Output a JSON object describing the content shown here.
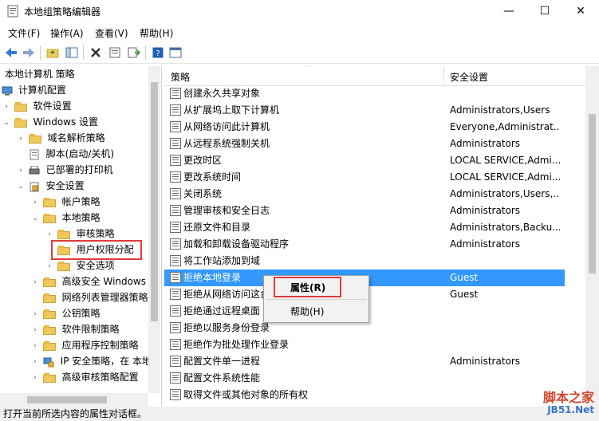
{
  "window": {
    "title": "本地组策略编辑器",
    "minimize": "—",
    "maximize": "☐",
    "close": "✕"
  },
  "menu": [
    "文件(F)",
    "操作(A)",
    "查看(V)",
    "帮助(H)"
  ],
  "tree": [
    {
      "label": "本地计算机 策略",
      "indent": 0,
      "arrow": "",
      "icon": "computer-icon"
    },
    {
      "label": "计算机配置",
      "indent": 1,
      "arrow": "",
      "icon": "computer-icon"
    },
    {
      "label": "软件设置",
      "indent": 1,
      "arrow": "›",
      "icon": "folder-icon"
    },
    {
      "label": "Windows 设置",
      "indent": 1,
      "arrow": "⌄",
      "icon": "folder-icon"
    },
    {
      "label": "域名解析策略",
      "indent": 2,
      "arrow": "›",
      "icon": "folder-icon"
    },
    {
      "label": "脚本(启动/关机)",
      "indent": 2,
      "arrow": "",
      "icon": "script-icon"
    },
    {
      "label": "已部署的打印机",
      "indent": 2,
      "arrow": "›",
      "icon": "printer-icon"
    },
    {
      "label": "安全设置",
      "indent": 2,
      "arrow": "⌄",
      "icon": "security-icon"
    },
    {
      "label": "帐户策略",
      "indent": 3,
      "arrow": "›",
      "icon": "folder-icon"
    },
    {
      "label": "本地策略",
      "indent": 3,
      "arrow": "⌄",
      "icon": "folder-icon"
    },
    {
      "label": "审核策略",
      "indent": 4,
      "arrow": "›",
      "icon": "folder-icon"
    },
    {
      "label": "用户权限分配",
      "indent": 4,
      "arrow": "",
      "icon": "folder-icon",
      "selected": true
    },
    {
      "label": "安全选项",
      "indent": 4,
      "arrow": "›",
      "icon": "folder-icon"
    },
    {
      "label": "高级安全 Windows",
      "indent": 3,
      "arrow": "›",
      "icon": "folder-icon"
    },
    {
      "label": "网络列表管理器策略",
      "indent": 3,
      "arrow": "",
      "icon": "folder-icon"
    },
    {
      "label": "公钥策略",
      "indent": 3,
      "arrow": "›",
      "icon": "folder-icon"
    },
    {
      "label": "软件限制策略",
      "indent": 3,
      "arrow": "›",
      "icon": "folder-icon"
    },
    {
      "label": "应用程序控制策略",
      "indent": 3,
      "arrow": "›",
      "icon": "folder-icon"
    },
    {
      "label": "IP 安全策略，在 本地",
      "indent": 3,
      "arrow": "›",
      "icon": "ip-security-icon"
    },
    {
      "label": "高级审核策略配置",
      "indent": 3,
      "arrow": "›",
      "icon": "folder-icon"
    }
  ],
  "list": {
    "headers": {
      "policy": "策略",
      "setting": "安全设置"
    },
    "rows": [
      {
        "name": "创建永久共享对象",
        "value": ""
      },
      {
        "name": "从扩展坞上取下计算机",
        "value": "Administrators,Users"
      },
      {
        "name": "从网络访问此计算机",
        "value": "Everyone,Administrat..."
      },
      {
        "name": "从远程系统强制关机",
        "value": "Administrators"
      },
      {
        "name": "更改时区",
        "value": "LOCAL SERVICE,Admi..."
      },
      {
        "name": "更改系统时间",
        "value": "LOCAL SERVICE,Admi..."
      },
      {
        "name": "关闭系统",
        "value": "Administrators,Users,..."
      },
      {
        "name": "管理审核和安全日志",
        "value": "Administrators"
      },
      {
        "name": "还原文件和目录",
        "value": "Administrators,Backu..."
      },
      {
        "name": "加载和卸载设备驱动程序",
        "value": "Administrators"
      },
      {
        "name": "将工作站添加到域",
        "value": ""
      },
      {
        "name": "拒绝本地登录",
        "value": "Guest",
        "selected": true
      },
      {
        "name": "拒绝从网络访问这台",
        "value": "Guest"
      },
      {
        "name": "拒绝通过远程桌面",
        "value": ""
      },
      {
        "name": "拒绝以服务身份登录",
        "value": ""
      },
      {
        "name": "拒绝作为批处理作业登录",
        "value": ""
      },
      {
        "name": "配置文件单一进程",
        "value": "Administrators"
      },
      {
        "name": "配置文件系统性能",
        "value": ""
      },
      {
        "name": "取得文件或其他对象的所有权",
        "value": ""
      }
    ]
  },
  "context_menu": {
    "properties": "属性(R)",
    "help": "帮助(H)"
  },
  "status": "打开当前所选内容的属性对话框。",
  "watermark": {
    "main": "脚本之家",
    "sub": "JB51.Net"
  },
  "colors": {
    "selection": "#3399ff",
    "highlight_box": "#e03c3c"
  }
}
